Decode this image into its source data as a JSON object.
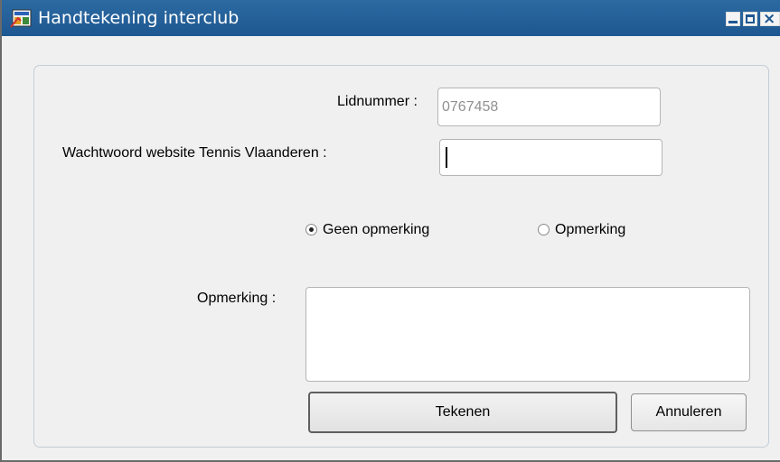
{
  "window": {
    "title": "Handtekening interclub",
    "controls": {
      "minimize_icon": "minimize-icon",
      "maximize_icon": "maximize-icon",
      "close_icon": "close-icon"
    }
  },
  "form": {
    "lidnummer": {
      "label": "Lidnummer :",
      "value": "0767458"
    },
    "wachtwoord": {
      "label": "Wachtwoord website Tennis Vlaanderen :",
      "value": ""
    },
    "radio_options": [
      {
        "label": "Geen opmerking",
        "checked": true
      },
      {
        "label": "Opmerking",
        "checked": false
      }
    ],
    "opmerking": {
      "label": "Opmerking :",
      "value": ""
    }
  },
  "buttons": {
    "primary": "Tekenen",
    "secondary": "Annuleren"
  },
  "colors": {
    "titlebar": "#1e5791",
    "panel_border": "#c3ced8"
  }
}
